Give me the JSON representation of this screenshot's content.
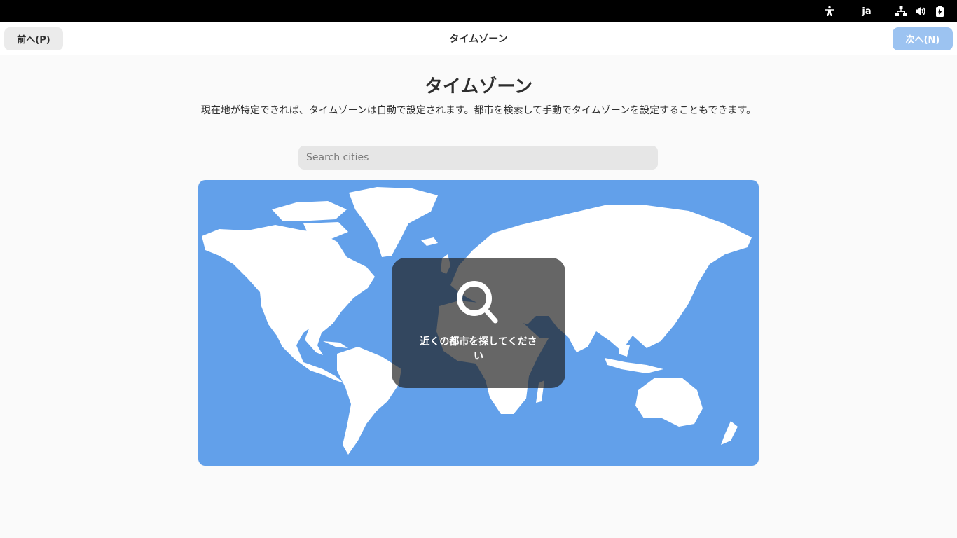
{
  "top_bar": {
    "language": "ja",
    "icons": [
      "accessibility-icon",
      "network-icon",
      "volume-icon",
      "battery-icon"
    ]
  },
  "header": {
    "title": "タイムゾーン",
    "prev_label": "前へ(P)",
    "next_label": "次へ(N)"
  },
  "main": {
    "title": "タイムゾーン",
    "description": "現在地が特定できれば、タイムゾーンは自動で設定されます。都市を検索して手動でタイムゾーンを設定することもできます。",
    "search_placeholder": "Search cities",
    "search_value": ""
  },
  "map": {
    "overlay_icon": "search-icon",
    "overlay_text": "近くの都市を探してください"
  },
  "colors": {
    "ocean": "#62a0ea",
    "land": "#ffffff",
    "next_disabled": "#9cc3f1"
  }
}
